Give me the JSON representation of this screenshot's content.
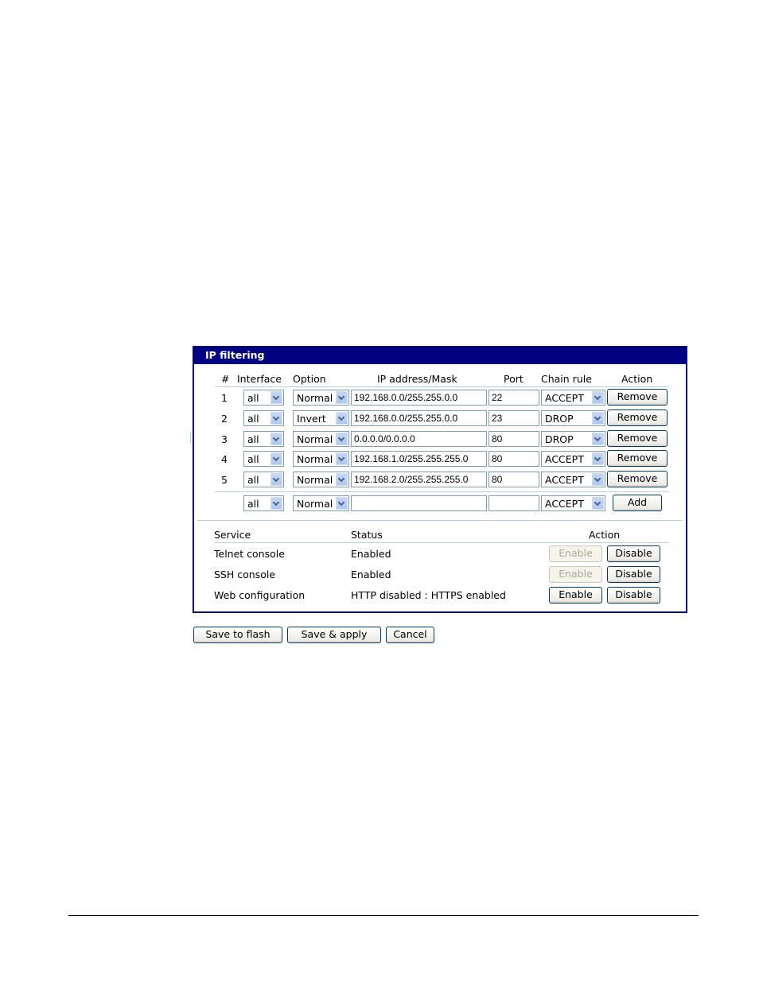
{
  "panel": {
    "title": "IP filtering",
    "columns": [
      "#",
      "Interface",
      "Option",
      "IP address/Mask",
      "Port",
      "Chain rule",
      "Action"
    ],
    "rules": [
      {
        "num": "1",
        "interface": "all",
        "option": "Normal",
        "ip_mask": "192.168.0.0/255.255.0.0",
        "port": "22",
        "chain": "ACCEPT",
        "action": "Remove"
      },
      {
        "num": "2",
        "interface": "all",
        "option": "Invert",
        "ip_mask": "192.168.0.0/255.255.0.0",
        "port": "23",
        "chain": "DROP",
        "action": "Remove"
      },
      {
        "num": "3",
        "interface": "all",
        "option": "Normal",
        "ip_mask": "0.0.0.0/0.0.0.0",
        "port": "80",
        "chain": "DROP",
        "action": "Remove"
      },
      {
        "num": "4",
        "interface": "all",
        "option": "Normal",
        "ip_mask": "192.168.1.0/255.255.255.0",
        "port": "80",
        "chain": "ACCEPT",
        "action": "Remove"
      },
      {
        "num": "5",
        "interface": "all",
        "option": "Normal",
        "ip_mask": "192.168.2.0/255.255.255.0",
        "port": "80",
        "chain": "ACCEPT",
        "action": "Remove"
      }
    ],
    "new_rule": {
      "interface": "all",
      "option": "Normal",
      "ip_mask": "",
      "port": "",
      "chain": "ACCEPT",
      "action": "Add"
    },
    "services_columns": [
      "Service",
      "Status",
      "Action"
    ],
    "services": [
      {
        "name": "Telnet console",
        "status": "Enabled",
        "enable_label": "Enable",
        "enable_disabled": true,
        "disable_label": "Disable"
      },
      {
        "name": "SSH console",
        "status": "Enabled",
        "enable_label": "Enable",
        "enable_disabled": true,
        "disable_label": "Disable"
      },
      {
        "name": "Web configuration",
        "status": "HTTP disabled : HTTPS enabled",
        "enable_label": "Enable",
        "enable_disabled": false,
        "disable_label": "Disable"
      }
    ]
  },
  "footer_buttons": {
    "save_flash": "Save to flash",
    "save_apply": "Save & apply",
    "cancel": "Cancel"
  },
  "colors": {
    "header_bg": "#000080",
    "divider": "#b8cfe8",
    "input_border": "#7f9db9"
  }
}
